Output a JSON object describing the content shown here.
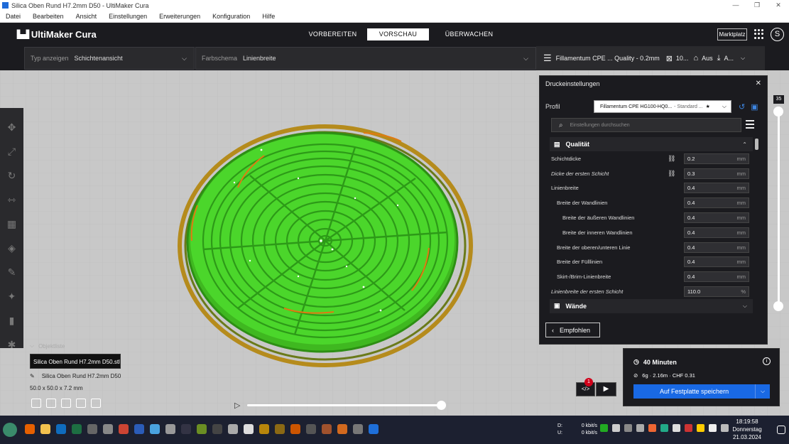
{
  "window": {
    "title": "Silica Oben Rund H7.2mm D50 - UltiMaker Cura",
    "controls": [
      "—",
      "❐",
      "✕"
    ]
  },
  "menu": [
    "Datei",
    "Bearbeiten",
    "Ansicht",
    "Einstellungen",
    "Erweiterungen",
    "Konfiguration",
    "Hilfe"
  ],
  "header": {
    "brand": "UltiMaker Cura",
    "tabs": [
      {
        "label": "VORBEREITEN",
        "active": false
      },
      {
        "label": "VORSCHAU",
        "active": true
      },
      {
        "label": "ÜBERWACHEN",
        "active": false
      }
    ],
    "marketplace": "Marktplatz",
    "avatar": "S"
  },
  "viewbar": {
    "type_label": "Typ anzeigen",
    "type_value": "Schichtenansicht",
    "color_label": "Farbschema",
    "color_value": "Linienbreite",
    "summary_material": "Fillamentum CPE ... Quality - 0.2mm",
    "summary_infill": "10...",
    "summary_support": "Aus",
    "summary_adhesion": "A..."
  },
  "layer_slider": {
    "current_layer": "35"
  },
  "print_settings": {
    "title": "Druckeinstellungen",
    "profile_label": "Profil",
    "profile_value": "Fillamentum CPE HG100-HQ0...",
    "profile_suffix": "- Standard ...",
    "search_placeholder": "Einstellungen durchsuchen",
    "section_quality": "Qualität",
    "section_walls": "Wände",
    "rows": [
      {
        "label": "Schichtdicke",
        "value": "0.2",
        "unit": "mm",
        "indent": 0,
        "italic": false,
        "linked": true
      },
      {
        "label": "Dicke der ersten Schicht",
        "value": "0.3",
        "unit": "mm",
        "indent": 0,
        "italic": true,
        "linked": true
      },
      {
        "label": "Linienbreite",
        "value": "0.4",
        "unit": "mm",
        "indent": 0,
        "italic": false,
        "linked": false
      },
      {
        "label": "Breite der Wandlinien",
        "value": "0.4",
        "unit": "mm",
        "indent": 1,
        "italic": false,
        "linked": false
      },
      {
        "label": "Breite der äußeren Wandlinien",
        "value": "0.4",
        "unit": "mm",
        "indent": 2,
        "italic": false,
        "linked": false
      },
      {
        "label": "Breite der inneren Wandlinien",
        "value": "0.4",
        "unit": "mm",
        "indent": 2,
        "italic": false,
        "linked": false
      },
      {
        "label": "Breite der oberen/unteren Linie",
        "value": "0.4",
        "unit": "mm",
        "indent": 1,
        "italic": false,
        "linked": false
      },
      {
        "label": "Breite der Fülllinien",
        "value": "0.4",
        "unit": "mm",
        "indent": 1,
        "italic": false,
        "linked": false
      },
      {
        "label": "Skirt-/Brim-Linienbreite",
        "value": "0.4",
        "unit": "mm",
        "indent": 1,
        "italic": false,
        "linked": false
      },
      {
        "label": "Linienbreite der ersten Schicht",
        "value": "110.0",
        "unit": "%",
        "indent": 0,
        "italic": true,
        "linked": false
      }
    ],
    "recommended_button": "Empfohlen"
  },
  "object_list": {
    "header": "Objektliste",
    "item": "Silica Oben Rund H7.2mm D50.stl",
    "name": "Silica Oben Rund H7.2mm D50",
    "dimensions": "50.0 x 50.0 x 7.2 mm"
  },
  "estimate": {
    "time": "40 Minuten",
    "material": "6g · 2.16m · CHF 0.31",
    "save_button": "Auf Festplatte speichern",
    "notification_count": "1"
  },
  "taskbar": {
    "net_down_label": "D:",
    "net_down": "0 kbit/s",
    "net_up_label": "U:",
    "net_up": "0 kbit/s",
    "time": "18:19:58",
    "day": "Donnerstag",
    "date": "21.03.2024"
  },
  "colors": {
    "accent": "#1969e4",
    "dark": "#1b1b1f",
    "viewport": "#c8c8c8",
    "print_green": "#4bd62b"
  }
}
